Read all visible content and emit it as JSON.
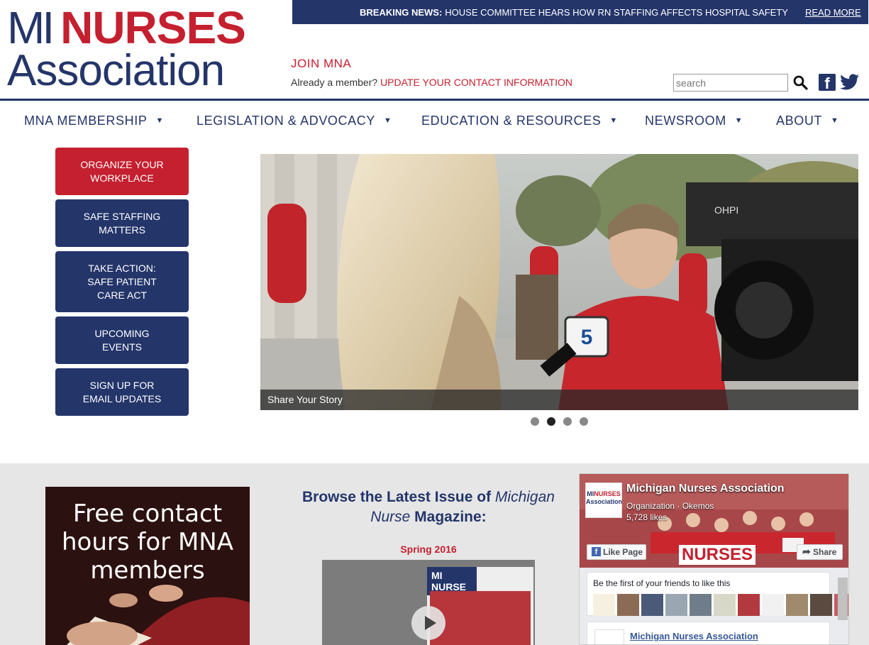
{
  "logo": {
    "mi": "MI",
    "nurses": "NURSES",
    "association": "Association"
  },
  "breaking": {
    "label": "BREAKING NEWS:",
    "text": "HOUSE COMMITTEE HEARS HOW RN STAFFING AFFECTS HOSPITAL SAFETY",
    "read_more": "READ MORE"
  },
  "join": {
    "label": "JOIN MNA",
    "already": "Already a member?",
    "update": "UPDATE YOUR CONTACT INFORMATION"
  },
  "search": {
    "placeholder": "search"
  },
  "nav": {
    "items": [
      {
        "label": "MNA MEMBERSHIP"
      },
      {
        "label": "LEGISLATION & ADVOCACY"
      },
      {
        "label": "EDUCATION & RESOURCES"
      },
      {
        "label": "NEWSROOM"
      },
      {
        "label": "ABOUT"
      }
    ],
    "caret": "▼"
  },
  "sidebar": {
    "buttons": [
      {
        "label": "ORGANIZE YOUR\nWORKPLACE"
      },
      {
        "label": "SAFE STAFFING\nMATTERS"
      },
      {
        "label": "TAKE ACTION:\nSAFE PATIENT\nCARE ACT"
      },
      {
        "label": "UPCOMING\nEVENTS"
      },
      {
        "label": "SIGN UP FOR\nEMAIL UPDATES"
      }
    ]
  },
  "slider": {
    "caption": "Share Your Story",
    "slide_count": 4,
    "active_index": 1,
    "mic_label": "5",
    "camera_brand": "OHPI"
  },
  "promo": {
    "text": "Free contact\nhours for MNA\nmembers"
  },
  "magazine": {
    "browse_prefix": "Browse the Latest Issue of ",
    "browse_title": "Michigan Nurse",
    "browse_suffix": " Magazine:",
    "issue": "Spring 2016",
    "cover_title": "MI NURSE"
  },
  "facebook": {
    "logo_line1": "MI",
    "logo_line2": "NURSES",
    "logo_line3": "Association",
    "name": "Michigan Nurses Association",
    "meta": "Organization · Okemos",
    "likes": "5,728 likes",
    "like_button": "Like Page",
    "share_button": "Share",
    "banner": "NURSES",
    "friends_text": "Be the first of your friends to like this",
    "post_name": "Michigan Nurses Association"
  },
  "colors": {
    "navy": "#24356a",
    "red": "#c4202f",
    "gray_band": "#e6e6e6"
  }
}
